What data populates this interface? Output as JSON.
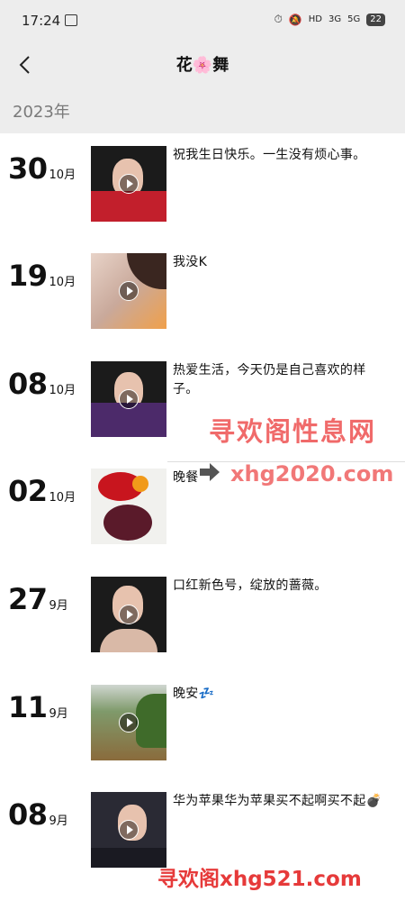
{
  "status_bar": {
    "time": "17:24",
    "network_labels": [
      "HD",
      "3G",
      "5G"
    ],
    "battery": "22"
  },
  "nav": {
    "title": "花🌸舞",
    "back_icon": "chevron-left-icon"
  },
  "year": "2023年",
  "posts": [
    {
      "day": "30",
      "month": "10月",
      "text": "祝我生日快乐。一生没有烦心事。",
      "media": "video"
    },
    {
      "day": "19",
      "month": "10月",
      "text": "我没K",
      "media": "video"
    },
    {
      "day": "08",
      "month": "10月",
      "text": "热爱生活，今天仍是自己喜欢的样子。",
      "media": "video"
    },
    {
      "day": "02",
      "month": "10月",
      "text": "晚餐",
      "media": "image"
    },
    {
      "day": "27",
      "month": "9月",
      "text": "口红新色号，绽放的蔷薇。",
      "media": "video"
    },
    {
      "day": "11",
      "month": "9月",
      "text": "晚安💤",
      "media": "video"
    },
    {
      "day": "08",
      "month": "9月",
      "text": "华为苹果华为苹果买不起啊买不起💣",
      "media": "video"
    }
  ],
  "watermarks": {
    "site_name": "寻欢阁性息网",
    "site_url": "xhg2020.com",
    "bottom": "寻欢阁xhg521.com"
  },
  "colors": {
    "header_bg": "#ededed",
    "watermark": "#ef5a5a"
  }
}
